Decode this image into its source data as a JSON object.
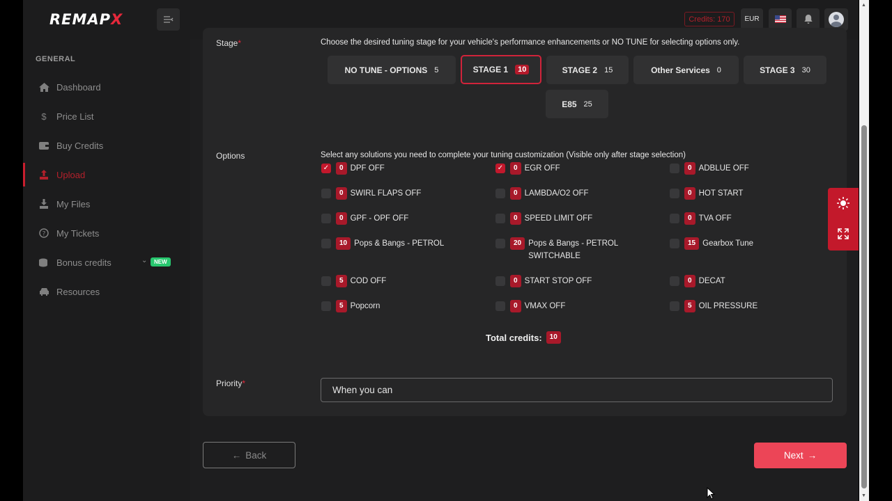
{
  "header": {
    "logo_main": "REMAP",
    "logo_x": "X",
    "credits": "Credits: 170",
    "currency": "EUR"
  },
  "sidebar": {
    "section": "GENERAL",
    "items": [
      {
        "label": "Dashboard",
        "icon": "home-icon"
      },
      {
        "label": "Price List",
        "icon": "dollar-icon"
      },
      {
        "label": "Buy Credits",
        "icon": "wallet-icon"
      },
      {
        "label": "Upload",
        "icon": "upload-icon",
        "active": true
      },
      {
        "label": "My Files",
        "icon": "download-icon"
      },
      {
        "label": "My Tickets",
        "icon": "help-circle-icon"
      },
      {
        "label": "Bonus credits",
        "icon": "coins-icon",
        "badge": "NEW"
      },
      {
        "label": "Resources",
        "icon": "car-icon"
      }
    ]
  },
  "stage": {
    "label": "Stage",
    "hint": "Choose the desired tuning stage for your vehicle's performance enhancements or NO TUNE for selecting options only.",
    "buttons": [
      {
        "label": "NO TUNE - OPTIONS",
        "value": "5"
      },
      {
        "label": "STAGE 1",
        "value": "10",
        "selected": true
      },
      {
        "label": "STAGE 2",
        "value": "15"
      },
      {
        "label": "Other Services",
        "value": "0"
      },
      {
        "label": "STAGE 3",
        "value": "30"
      },
      {
        "label": "E85",
        "value": "25"
      }
    ]
  },
  "options": {
    "label": "Options",
    "hint": "Select any solutions you need to complete your tuning customization (Visible only after stage selection)",
    "items": [
      {
        "label": "DPF OFF",
        "credits": "0",
        "checked": true
      },
      {
        "label": "EGR OFF",
        "credits": "0",
        "checked": true
      },
      {
        "label": "ADBLUE OFF",
        "credits": "0",
        "checked": false
      },
      {
        "label": "SWIRL FLAPS OFF",
        "credits": "0",
        "checked": false
      },
      {
        "label": "LAMBDA/O2 OFF",
        "credits": "0",
        "checked": false
      },
      {
        "label": "HOT START",
        "credits": "0",
        "checked": false
      },
      {
        "label": "GPF - OPF OFF",
        "credits": "0",
        "checked": false
      },
      {
        "label": "SPEED LIMIT OFF",
        "credits": "0",
        "checked": false
      },
      {
        "label": "TVA OFF",
        "credits": "0",
        "checked": false
      },
      {
        "label": "Pops & Bangs - PETROL",
        "credits": "10",
        "checked": false
      },
      {
        "label": "Pops & Bangs - PETROL SWITCHABLE",
        "credits": "20",
        "checked": false
      },
      {
        "label": "Gearbox Tune",
        "credits": "15",
        "checked": false
      },
      {
        "label": "COD OFF",
        "credits": "5",
        "checked": false
      },
      {
        "label": "START STOP OFF",
        "credits": "0",
        "checked": false
      },
      {
        "label": "DECAT",
        "credits": "0",
        "checked": false
      },
      {
        "label": "Popcorn",
        "credits": "5",
        "checked": false
      },
      {
        "label": "VMAX OFF",
        "credits": "0",
        "checked": false
      },
      {
        "label": "OIL PRESSURE",
        "credits": "5",
        "checked": false
      }
    ],
    "total_label": "Total credits:",
    "total_value": "10"
  },
  "priority": {
    "label": "Priority",
    "value": "When you can"
  },
  "footer": {
    "back_label": "Back",
    "next_label": "Next"
  },
  "colors": {
    "accent": "#e5283b",
    "next_button": "#ec4557",
    "badge": "#a8192a"
  }
}
